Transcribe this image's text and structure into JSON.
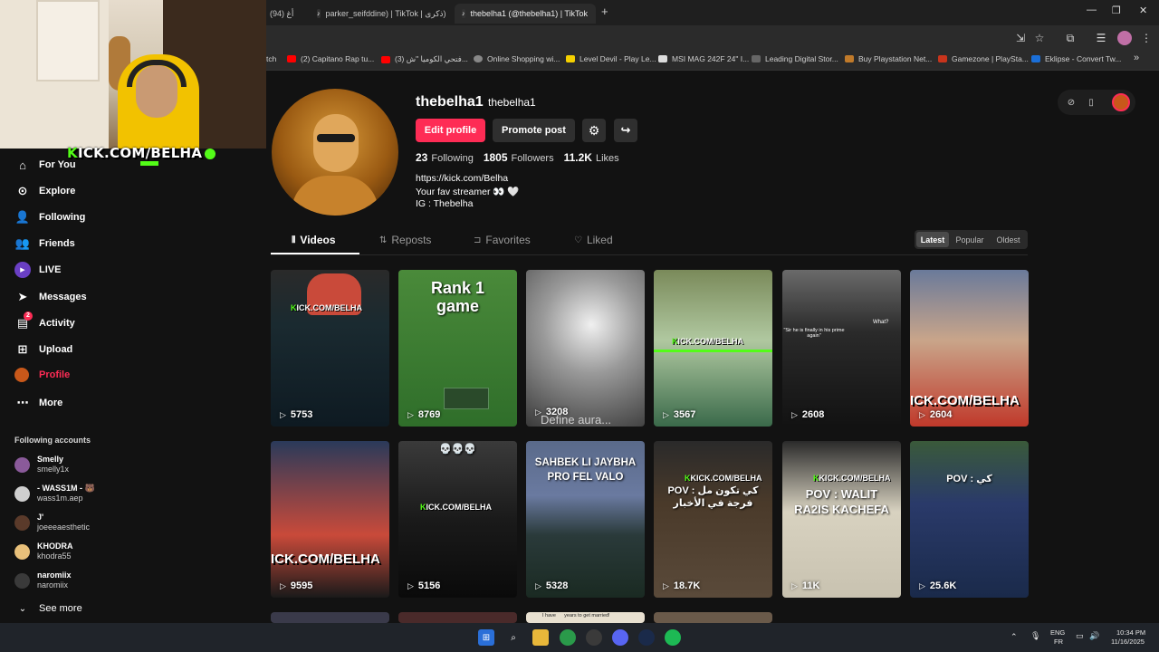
{
  "browser": {
    "tabs": [
      {
        "label": "(94) أغ",
        "active": false
      },
      {
        "label": "parker_seifddine) | TikTok | ذكرى)",
        "active": false
      },
      {
        "label": "thebelha1 (@thebelha1) | TikTok",
        "active": true
      }
    ],
    "new_tab": "+",
    "window_controls": {
      "minimize": "—",
      "restore": "❐",
      "close": "✕"
    },
    "bookmarks": [
      "tch",
      "(2) Capitano Rap tu...",
      "(3) فتحي الكوميا \"ش...",
      "Online Shopping wi...",
      "Level Devil - Play Le...",
      "MSI MAG 242F 24\" I...",
      "Leading Digital Stor...",
      "Buy Playstation Net...",
      "Gamezone | PlaySta...",
      "Eklipse - Convert Tw..."
    ],
    "bookmarks_more": "»"
  },
  "stream_overlay": {
    "kick_label_k": "K",
    "kick_label": "ICK.COM/BELHA"
  },
  "nav": {
    "items": [
      {
        "label": "For You",
        "icon": "home-icon",
        "glyph": "⌂"
      },
      {
        "label": "Explore",
        "icon": "compass-icon",
        "glyph": "⊙"
      },
      {
        "label": "Following",
        "icon": "following-icon",
        "glyph": "👤"
      },
      {
        "label": "Friends",
        "icon": "friends-icon",
        "glyph": "👥"
      },
      {
        "label": "LIVE",
        "icon": "live-icon",
        "glyph": "●"
      },
      {
        "label": "Messages",
        "icon": "send-icon",
        "glyph": "➤"
      },
      {
        "label": "Activity",
        "icon": "activity-icon",
        "glyph": "▤"
      },
      {
        "label": "Upload",
        "icon": "upload-icon",
        "glyph": "⊞"
      },
      {
        "label": "Profile",
        "icon": "profile-icon",
        "glyph": "●"
      },
      {
        "label": "More",
        "icon": "more-icon",
        "glyph": "⋯"
      }
    ],
    "activity_badge": "2",
    "following_heading": "Following accounts",
    "accounts": [
      {
        "name": "Smelly",
        "handle": "smelly1x",
        "color": "#8a5a9a"
      },
      {
        "name": "- WASS1M - 🐻",
        "handle": "wass1m.aep",
        "color": "#cfcfcf"
      },
      {
        "name": "J'",
        "handle": "joeeeaesthetic",
        "color": "#5a3a2a"
      },
      {
        "name": "KHODRA",
        "handle": "khodra55",
        "color": "#e8c07a"
      },
      {
        "name": "naromiix",
        "handle": "naromiix",
        "color": "#3a3a3a"
      }
    ],
    "see_more": "See more"
  },
  "profile": {
    "name": "thebelha1",
    "handle": "thebelha1",
    "edit_label": "Edit profile",
    "promote_label": "Promote post",
    "following_count": "23",
    "following_label": "Following",
    "followers_count": "1805",
    "followers_label": "Followers",
    "likes_count": "11.2K",
    "likes_label": "Likes",
    "bio": [
      "https://kick.com/Belha",
      "Your fav streamer 👀 🤍",
      "IG : Thebelha"
    ]
  },
  "tabs": [
    {
      "label": "Videos",
      "glyph": "⦀"
    },
    {
      "label": "Reposts",
      "glyph": "⇅"
    },
    {
      "label": "Favorites",
      "glyph": "⊐"
    },
    {
      "label": "Liked",
      "glyph": "♡"
    }
  ],
  "sort": [
    "Latest",
    "Popular",
    "Oldest"
  ],
  "videos": [
    {
      "views": "5753",
      "caption": ""
    },
    {
      "views": "8769",
      "caption": "Rank 1 game"
    },
    {
      "views": "3208",
      "caption": "Define aura..."
    },
    {
      "views": "3567",
      "caption": ""
    },
    {
      "views": "2608",
      "caption": "\"Sir he is finally in his prime again\""
    },
    {
      "views": "2604",
      "caption": ""
    },
    {
      "views": "9595",
      "caption": ""
    },
    {
      "views": "5156",
      "caption": "💀💀💀"
    },
    {
      "views": "5328",
      "caption": "SAHBEK LI JAYBHA PRO FEL VALO"
    },
    {
      "views": "18.7K",
      "caption": "POV : كي تكون مل فرجة في الأخبار"
    },
    {
      "views": "11K",
      "caption": "POV : WALIT RA2IS KACHEFA"
    },
    {
      "views": "25.6K",
      "caption": "POV : كي"
    }
  ],
  "video_extras": {
    "what": "What?",
    "kick_short": "ICK.COM/BELHA",
    "kick_k": "K",
    "kick_small": "KICK.COM/BELHA",
    "yrs": "I have      years to get married!"
  },
  "taskbar": {
    "lang": "ENG",
    "region": "FR",
    "time": "10:34 PM",
    "date": "11/16/2025"
  }
}
